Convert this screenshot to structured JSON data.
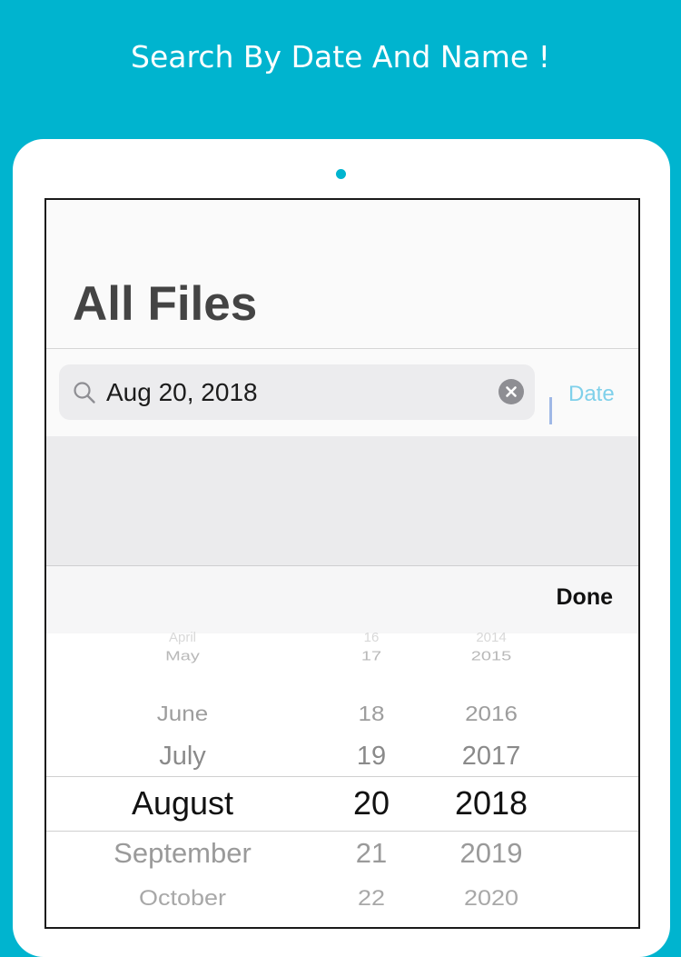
{
  "banner": {
    "headline": "Search By Date And Name !"
  },
  "screen": {
    "title": "All Files",
    "search": {
      "value": "Aug 20, 2018",
      "placeholder": ""
    },
    "date_button_label": "Date",
    "done_label": "Done"
  },
  "picker": {
    "months": [
      "April",
      "May",
      "June",
      "July",
      "August",
      "September",
      "October"
    ],
    "days": [
      "16",
      "17",
      "18",
      "19",
      "20",
      "21",
      "22"
    ],
    "years": [
      "2014",
      "2015",
      "2016",
      "2017",
      "2018",
      "2019",
      "2020"
    ],
    "selected": {
      "month": "August",
      "day": "20",
      "year": "2018"
    }
  },
  "colors": {
    "banner_background": "#00b4cf",
    "accent": "#7fd0ea"
  },
  "icons": {
    "search": "search-icon",
    "clear": "clear-icon"
  }
}
